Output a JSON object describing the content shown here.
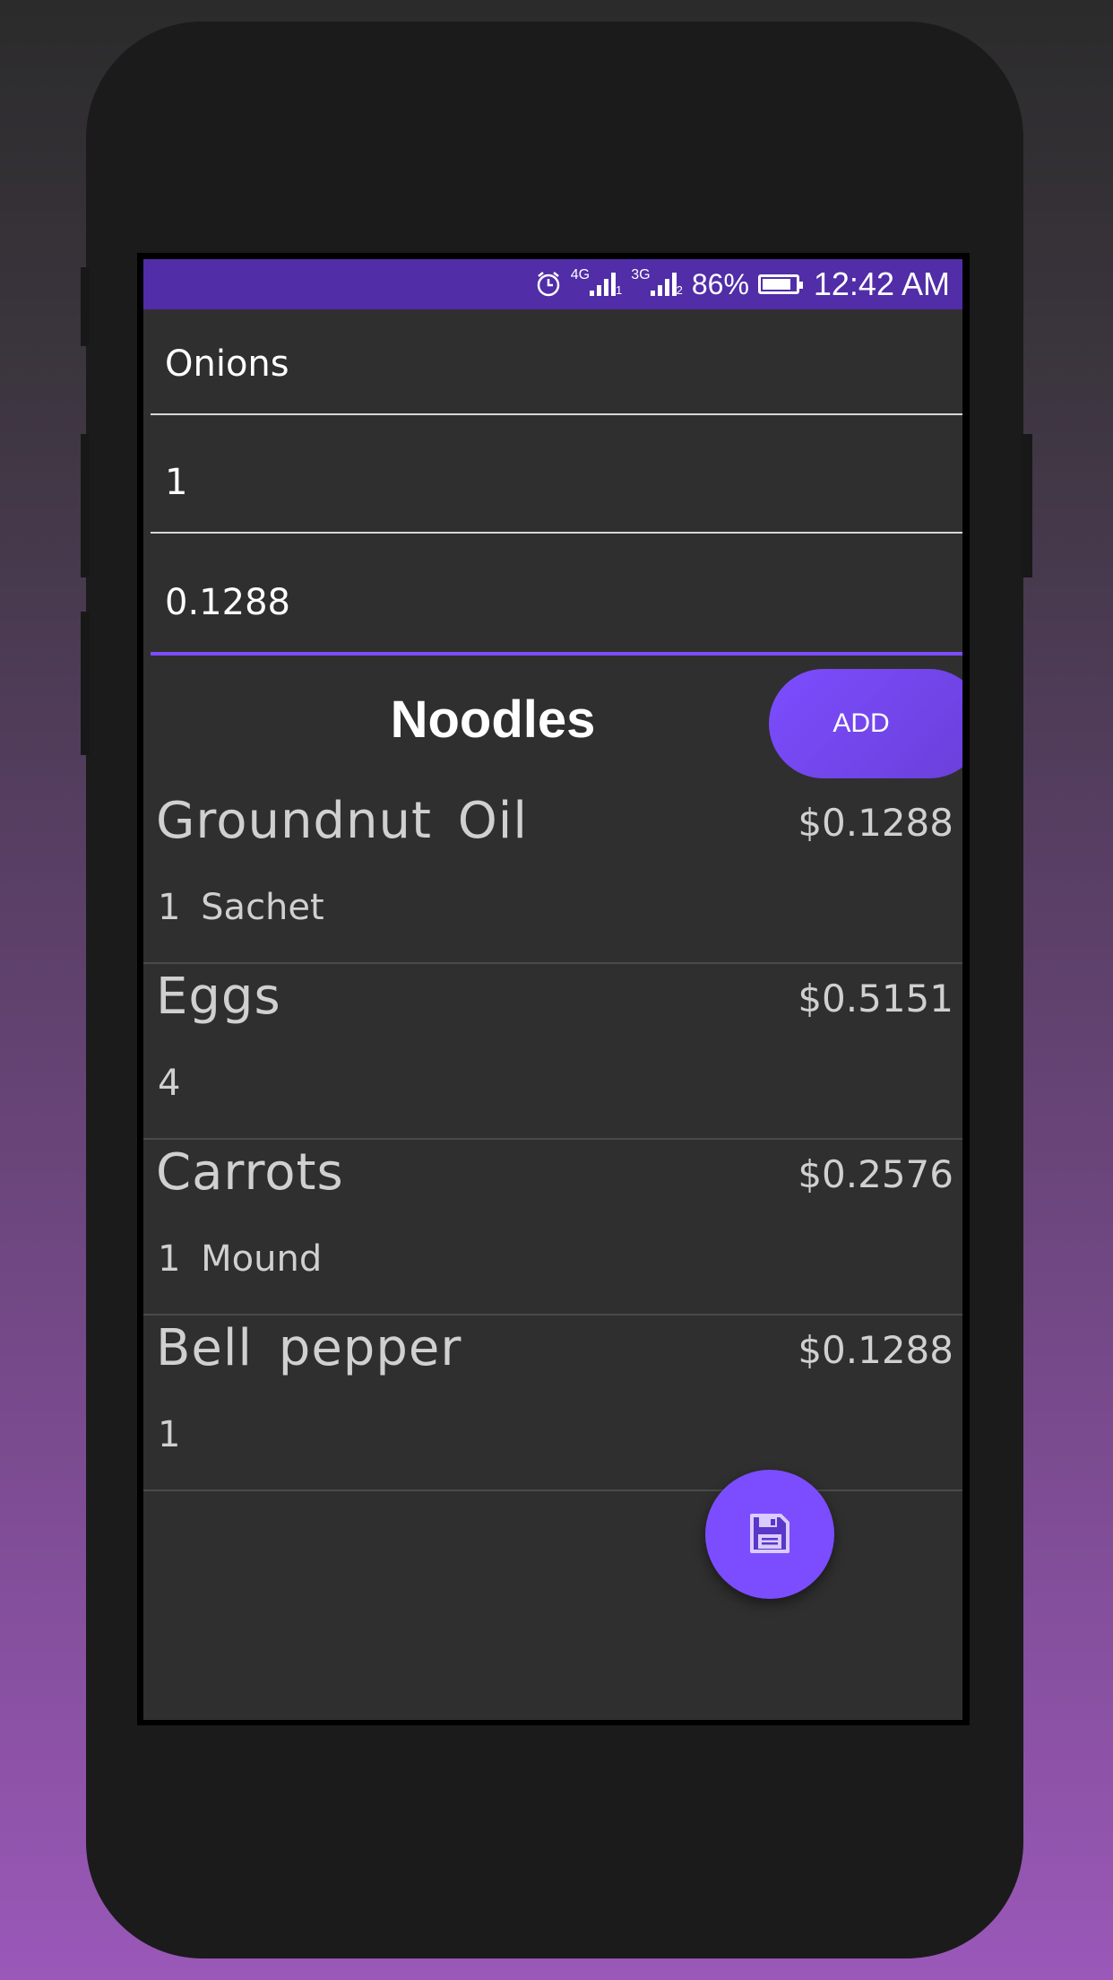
{
  "status_bar": {
    "network_1": "4G",
    "sim_1": "1",
    "network_2": "3G",
    "sim_2": "2",
    "battery_percent": "86%",
    "battery_level": 0.86,
    "time": "12:42 AM",
    "icons": [
      "alarm-icon",
      "signal-icon",
      "battery-icon"
    ]
  },
  "form": {
    "item_name": "Onions",
    "quantity": "1",
    "price": "0.1288"
  },
  "recipe": {
    "title": "Noodles",
    "add_label": "ADD"
  },
  "ingredients": [
    {
      "name": "Groundnut Oil",
      "price": "$0.1288",
      "qty": "1 Sachet"
    },
    {
      "name": "Eggs",
      "price": "$0.5151",
      "qty": "4"
    },
    {
      "name": "Carrots",
      "price": "$0.2576",
      "qty": "1 Mound"
    },
    {
      "name": "Bell pepper",
      "price": "$0.1288",
      "qty": "1"
    }
  ],
  "fab": {
    "icon": "save-icon"
  },
  "colors": {
    "accent": "#7c4dff",
    "status_bar": "#512da8",
    "background": "#2f2f2f"
  }
}
